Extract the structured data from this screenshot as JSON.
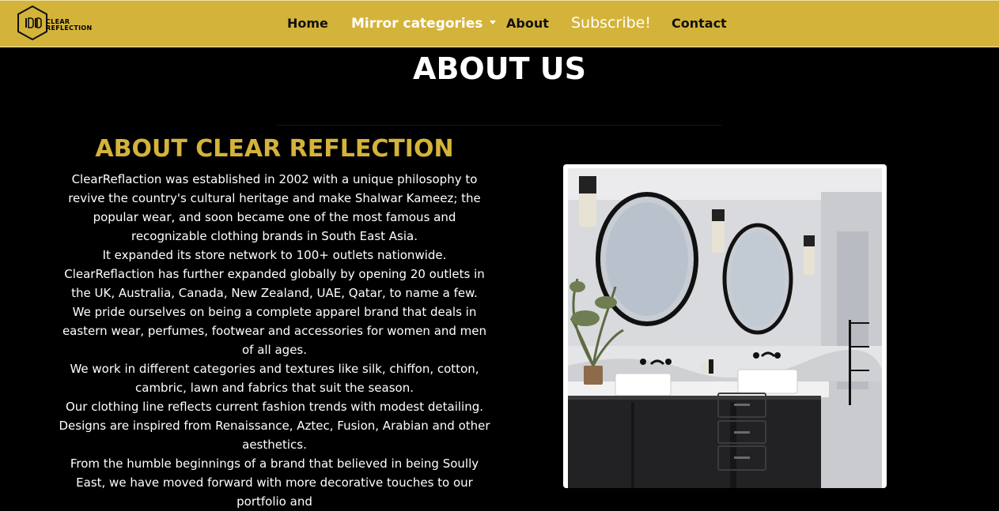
{
  "nav": {
    "logo_line1": "CLEAR",
    "logo_line2": "REFLECTION",
    "home": "Home",
    "categories": "Mirror categories",
    "about": "About",
    "subscribe": "Subscribe!",
    "contact": "Contact"
  },
  "page": {
    "title": "ABOUT US"
  },
  "about": {
    "heading": "ABOUT CLEAR REFLECTION",
    "paragraphs": [
      "ClearReflaction was established in 2002 with a unique philosophy to revive the country's cultural heritage and make Shalwar Kameez; the popular wear, and soon became one of the most famous and recognizable clothing brands in South East Asia.",
      "It expanded its store network to 100+ outlets nationwide. ClearReflaction has further expanded globally by opening 20 outlets in the UK, Australia, Canada, New Zealand, UAE, Qatar, to name a few.",
      "We pride ourselves on being a complete apparel brand that deals in eastern wear, perfumes, footwear and accessories for women and men of all ages.",
      "We work in different categories and textures like silk, chiffon, cotton, cambric, lawn and fabrics that suit the season.",
      "Our clothing line reflects current fashion trends with modest detailing.",
      "Designs are inspired from Renaissance, Aztec, Fusion, Arabian and other aesthetics.",
      "From the humble beginnings of a brand that believed in being Soully East, we have moved forward with more decorative touches to our portfolio and"
    ]
  },
  "colors": {
    "navbar": "#d4b33a",
    "heading_gold": "#d4b33a",
    "background": "#000000"
  },
  "icons": {
    "logo": "clear-reflection-hexagon-logo",
    "dropdown": "caret-down-icon"
  }
}
